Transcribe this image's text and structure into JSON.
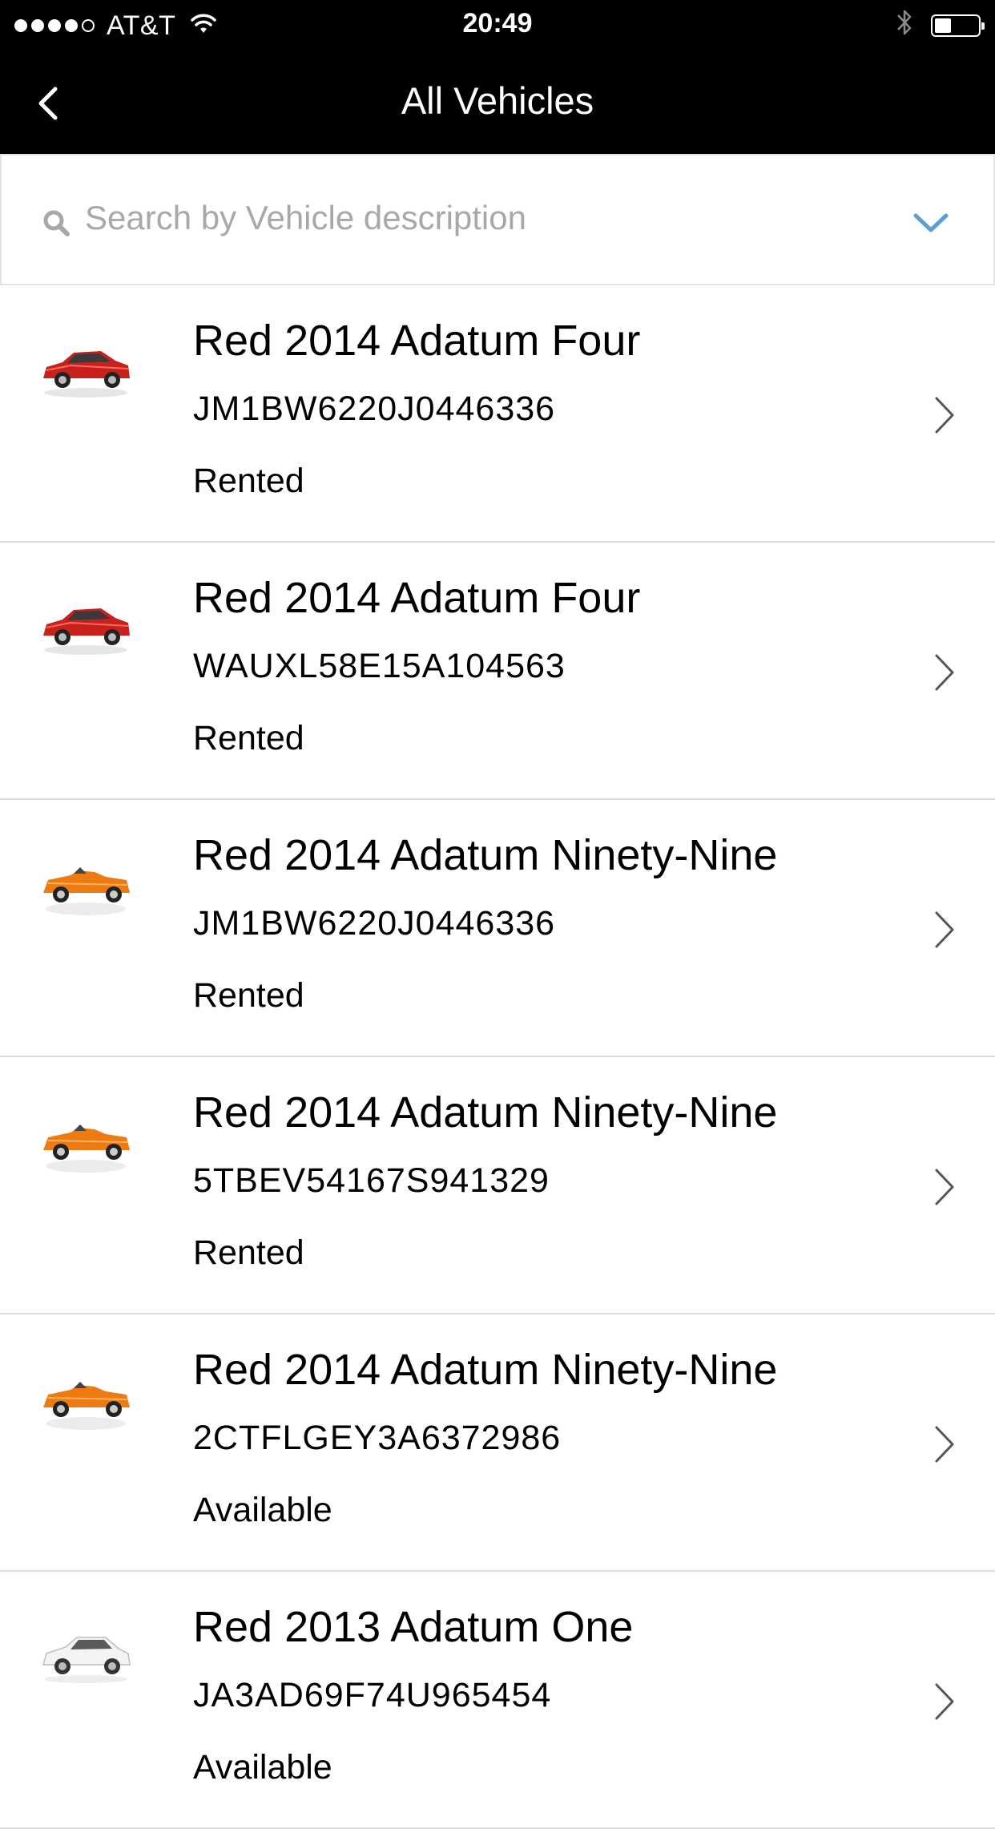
{
  "status_bar": {
    "carrier": "AT&T",
    "time": "20:49",
    "signal_bars_filled": 4,
    "signal_bars_total": 5,
    "battery_level": 0.3
  },
  "nav": {
    "title": "All Vehicles"
  },
  "search": {
    "placeholder": "Search by Vehicle description",
    "value": ""
  },
  "colors": {
    "nav_background": "#000000",
    "accent": "#5a9fd6",
    "placeholder": "#a8a8a8",
    "divider": "#dcdcdc"
  },
  "vehicles": [
    {
      "name": "Red 2014 Adatum Four",
      "vin": "JM1BW6220J0446336",
      "status": "Rented",
      "thumb_icon": "red-sedan-icon"
    },
    {
      "name": "Red 2014 Adatum Four",
      "vin": "WAUXL58E15A104563",
      "status": "Rented",
      "thumb_icon": "red-sedan-icon"
    },
    {
      "name": "Red 2014 Adatum Ninety-Nine",
      "vin": "JM1BW6220J0446336",
      "status": "Rented",
      "thumb_icon": "orange-convertible-icon"
    },
    {
      "name": "Red 2014 Adatum Ninety-Nine",
      "vin": "5TBEV54167S941329",
      "status": "Rented",
      "thumb_icon": "orange-convertible-icon"
    },
    {
      "name": "Red 2014 Adatum Ninety-Nine",
      "vin": "2CTFLGEY3A6372986",
      "status": "Available",
      "thumb_icon": "orange-convertible-icon"
    },
    {
      "name": "Red 2013 Adatum One",
      "vin": "JA3AD69F74U965454",
      "status": "Available",
      "thumb_icon": "white-hatchback-icon"
    }
  ]
}
